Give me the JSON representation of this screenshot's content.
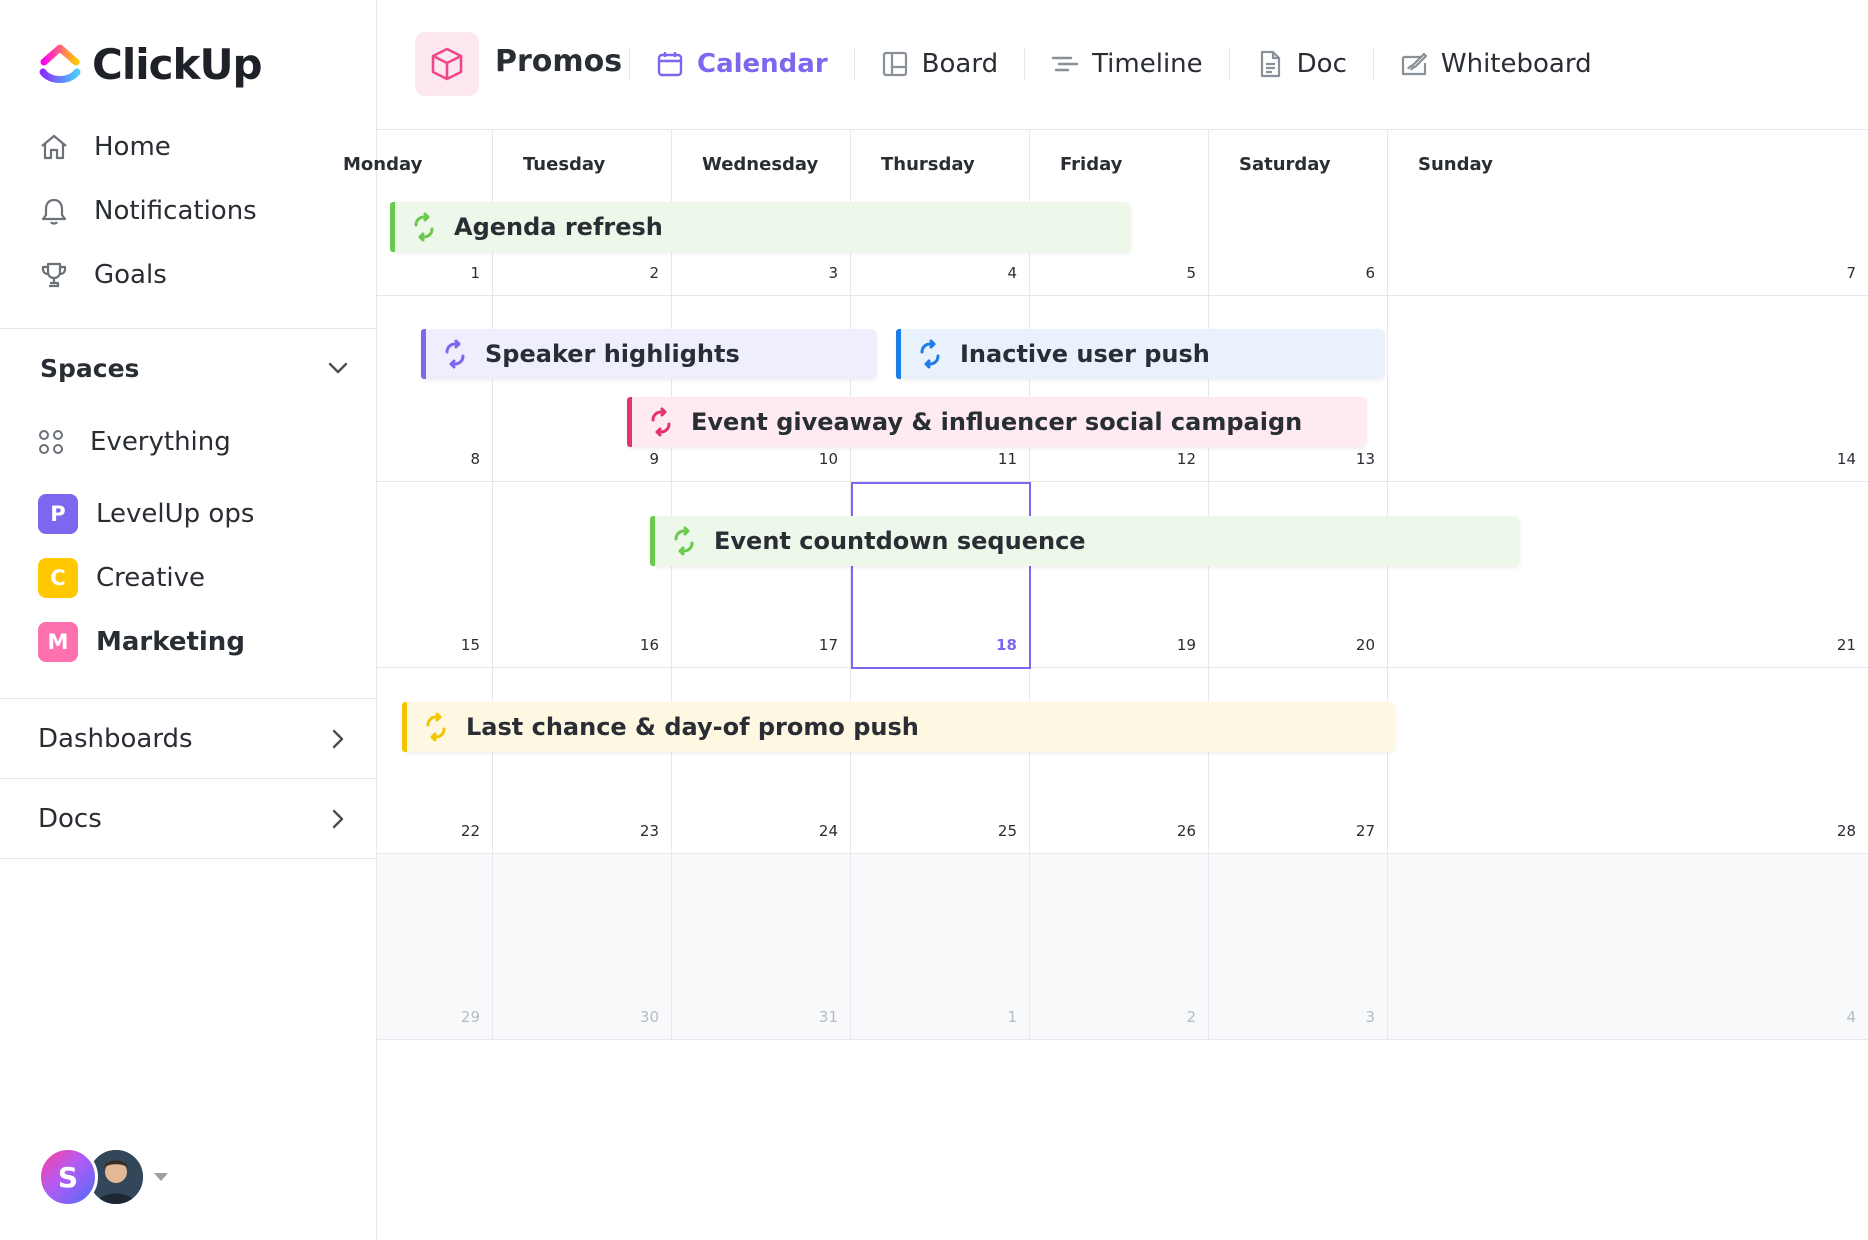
{
  "brand": {
    "name": "ClickUp"
  },
  "nav": [
    {
      "label": "Home",
      "icon": "home-icon"
    },
    {
      "label": "Notifications",
      "icon": "bell-icon"
    },
    {
      "label": "Goals",
      "icon": "trophy-icon"
    }
  ],
  "spaces": {
    "header": "Spaces",
    "everything": "Everything",
    "items": [
      {
        "badge": "P",
        "label": "LevelUp ops",
        "color": "#7b68ee"
      },
      {
        "badge": "C",
        "label": "Creative",
        "color": "#ffc800"
      },
      {
        "badge": "M",
        "label": "Marketing",
        "color": "#fd71af"
      }
    ]
  },
  "sections": {
    "dashboards": "Dashboards",
    "docs": "Docs"
  },
  "user": {
    "initial": "S"
  },
  "toolbar": {
    "list_title": "Promos",
    "tabs": [
      {
        "label": "Calendar",
        "icon": "calendar-icon",
        "active": true
      },
      {
        "label": "Board",
        "icon": "board-icon",
        "active": false
      },
      {
        "label": "Timeline",
        "icon": "timeline-icon",
        "active": false
      },
      {
        "label": "Doc",
        "icon": "doc-icon",
        "active": false
      },
      {
        "label": "Whiteboard",
        "icon": "whiteboard-icon",
        "active": false
      }
    ]
  },
  "calendar": {
    "day_names": [
      "Monday",
      "Tuesday",
      "Wednesday",
      "Thursday",
      "Friday",
      "Saturday",
      "Sunday"
    ],
    "weeks": [
      [
        "1",
        "2",
        "3",
        "4",
        "5",
        "6",
        "7"
      ],
      [
        "8",
        "9",
        "10",
        "11",
        "12",
        "13",
        "14"
      ],
      [
        "15",
        "16",
        "17",
        "18",
        "19",
        "20",
        "21"
      ],
      [
        "22",
        "23",
        "24",
        "25",
        "26",
        "27",
        "28"
      ],
      [
        "29",
        "30",
        "31",
        "1",
        "2",
        "3",
        "4"
      ]
    ],
    "today": "18",
    "events": [
      {
        "title": "Agenda refresh",
        "color": "#6bc950",
        "bg": "#edf8ea"
      },
      {
        "title": "Speaker highlights",
        "color": "#7b68ee",
        "bg": "#efeefc"
      },
      {
        "title": "Inactive user push",
        "color": "#1e7ce6",
        "bg": "#e8f1fc"
      },
      {
        "title": "Event giveaway & influencer social campaign",
        "color": "#e5326d",
        "bg": "#fdebf1"
      },
      {
        "title": "Event countdown sequence",
        "color": "#6bc950",
        "bg": "#edf8ea"
      },
      {
        "title": "Last chance & day-of promo push",
        "color": "#f5c400",
        "bg": "#fef8e3"
      }
    ]
  }
}
